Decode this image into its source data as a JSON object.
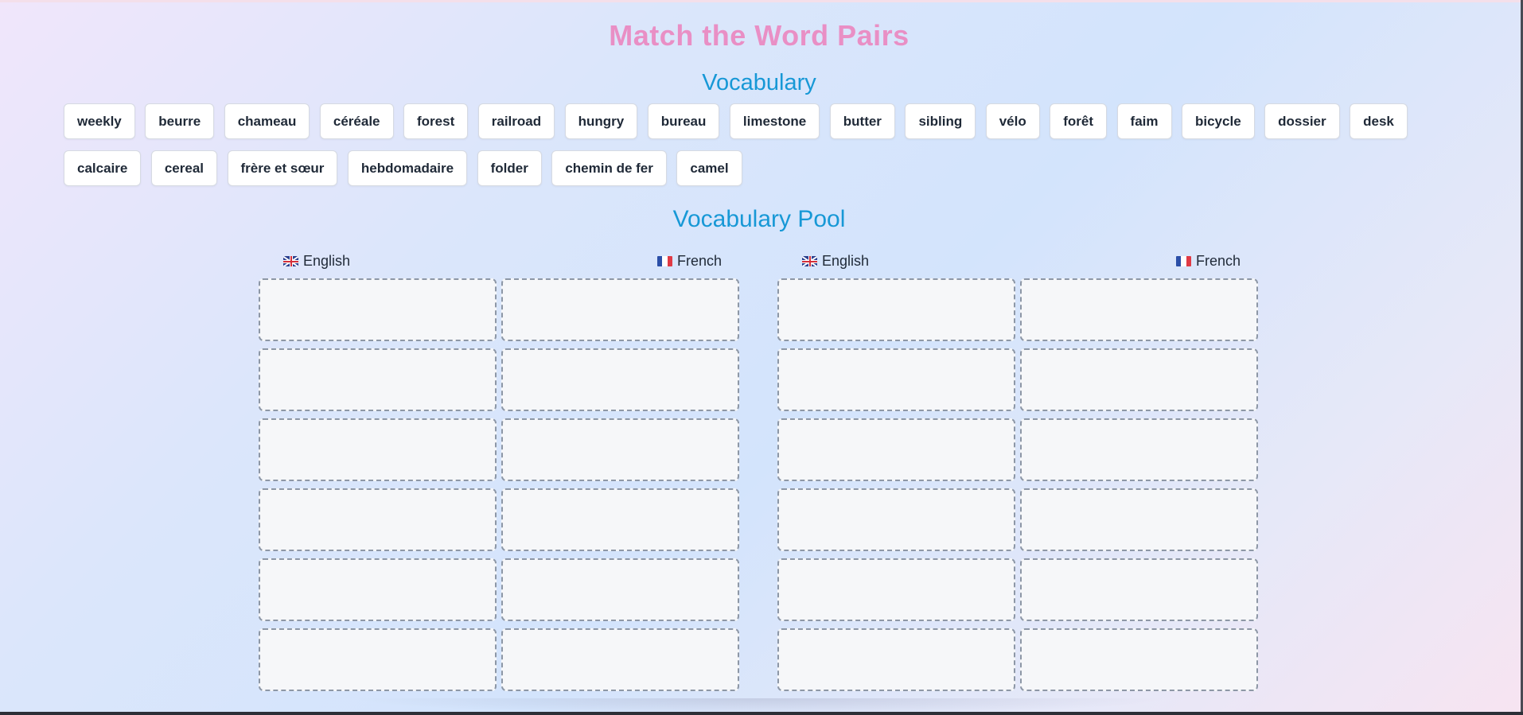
{
  "title": "Match the Word Pairs",
  "vocabulary_heading": "Vocabulary",
  "vocabulary_words": [
    "weekly",
    "beurre",
    "chameau",
    "céréale",
    "forest",
    "railroad",
    "hungry",
    "bureau",
    "limestone",
    "butter",
    "sibling",
    "vélo",
    "forêt",
    "faim",
    "bicycle",
    "dossier",
    "desk",
    "calcaire",
    "cereal",
    "frère et sœur",
    "hebdomadaire",
    "folder",
    "chemin de fer",
    "camel"
  ],
  "pool_heading": "Vocabulary Pool",
  "pool_groups": [
    {
      "english_header": "English",
      "english_flag": "uk-flag-icon",
      "french_header": "French",
      "french_flag": "france-flag-icon",
      "pairs": [
        {
          "english": "",
          "french": ""
        },
        {
          "english": "",
          "french": ""
        },
        {
          "english": "",
          "french": ""
        },
        {
          "english": "",
          "french": ""
        },
        {
          "english": "",
          "french": ""
        },
        {
          "english": "",
          "french": ""
        }
      ]
    },
    {
      "english_header": "English",
      "english_flag": "uk-flag-icon",
      "french_header": "French",
      "french_flag": "france-flag-icon",
      "pairs": [
        {
          "english": "",
          "french": ""
        },
        {
          "english": "",
          "french": ""
        },
        {
          "english": "",
          "french": ""
        },
        {
          "english": "",
          "french": ""
        },
        {
          "english": "",
          "french": ""
        },
        {
          "english": "",
          "french": ""
        }
      ]
    }
  ],
  "colors": {
    "title": "#e98fc5",
    "heading": "#1798d6",
    "tile_text": "#1f2937",
    "slot_border": "#8d97a6"
  }
}
